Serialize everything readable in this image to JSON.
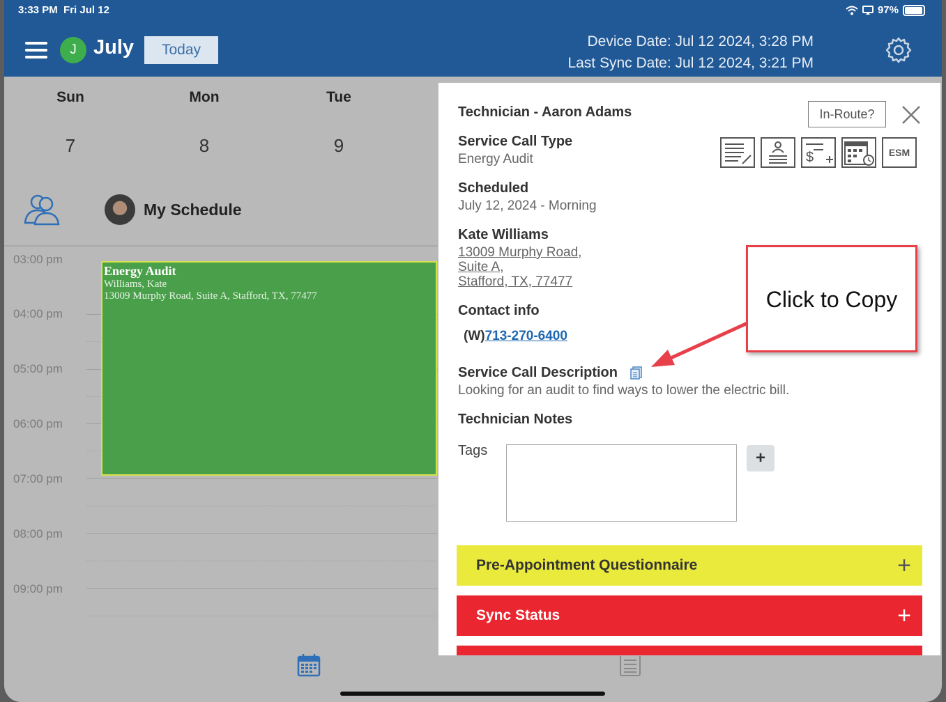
{
  "status": {
    "time": "3:33 PM",
    "date": "Fri Jul 12",
    "battery": "97%"
  },
  "header": {
    "avatar_initial": "J",
    "month": "July",
    "today_label": "Today",
    "device_date": "Device Date: Jul 12 2024, 3:28 PM",
    "last_sync": "Last Sync Date: Jul 12 2024, 3:21 PM"
  },
  "calendar": {
    "days": [
      {
        "name": "Sun",
        "num": "7"
      },
      {
        "name": "Mon",
        "num": "8"
      },
      {
        "name": "Tue",
        "num": "9"
      }
    ],
    "my_schedule": "My Schedule",
    "times": [
      "03:00 pm",
      "04:00 pm",
      "05:00 pm",
      "06:00 pm",
      "07:00 pm",
      "08:00 pm",
      "09:00 pm"
    ],
    "event": {
      "title": "Energy Audit",
      "name": "Williams, Kate",
      "address": "13009 Murphy Road, Suite A, Stafford, TX, 77477",
      "color": "#4aa04a"
    }
  },
  "panel": {
    "technician": "Technician - Aaron Adams",
    "in_route_label": "In-Route?",
    "service_call_type_label": "Service Call Type",
    "service_call_type": "Energy Audit",
    "scheduled_label": "Scheduled",
    "scheduled": "July 12, 2024 - Morning",
    "customer": "Kate Williams",
    "address_line1": "13009 Murphy Road,",
    "address_line2": "Suite A,",
    "address_line3": "Stafford, TX, 77477",
    "contact_label": "Contact info",
    "phone_prefix": "(W)",
    "phone": "713-270-6400",
    "description_label": "Service Call Description",
    "description": "Looking for an audit to find ways to lower the electric bill.",
    "notes_label": "Technician Notes",
    "tags_label": "Tags",
    "esm_label": "ESM",
    "bars": [
      {
        "label": "Pre-Appointment Questionnaire",
        "color": "#eaea3c"
      },
      {
        "label": "Sync Status",
        "color": "#ea2630"
      }
    ]
  },
  "callout": {
    "text": "Click to Copy"
  }
}
